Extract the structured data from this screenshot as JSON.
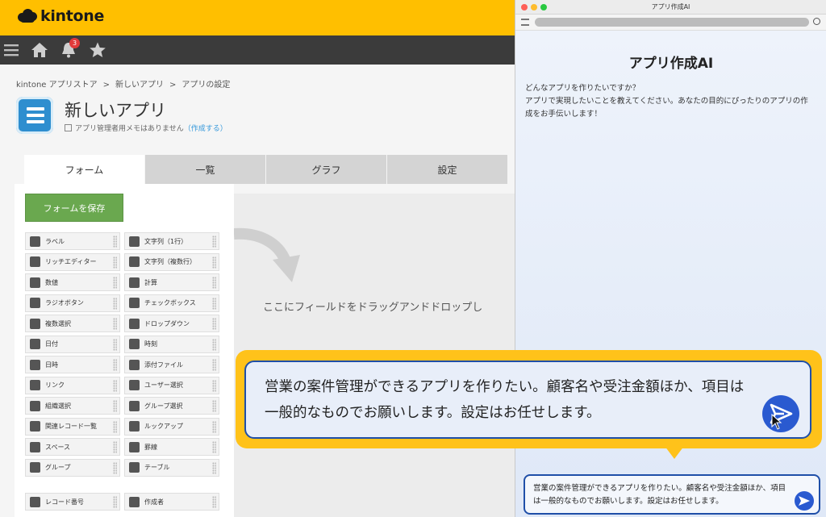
{
  "brand": {
    "logo_text": "kintone"
  },
  "nav": {
    "notification_count": "3"
  },
  "breadcrumb": [
    "kintone アプリストア",
    "新しいアプリ",
    "アプリの設定"
  ],
  "breadcrumb_sep": ">",
  "app": {
    "title": "新しいアプリ",
    "memo": "アプリ管理者用メモはありません",
    "memo_link": "（作成する）"
  },
  "tabs": [
    "フォーム",
    "一覧",
    "グラフ",
    "設定"
  ],
  "form": {
    "save_label": "フォームを保存",
    "fields_left": [
      "ラベル",
      "リッチエディター",
      "数値",
      "ラジオボタン",
      "複数選択",
      "日付",
      "日時",
      "リンク",
      "組織選択",
      "関連レコード一覧",
      "スペース",
      "グループ"
    ],
    "fields_right": [
      "文字列（1行）",
      "文字列（複数行）",
      "計算",
      "チェックボックス",
      "ドロップダウン",
      "時刻",
      "添付ファイル",
      "ユーザー選択",
      "グループ選択",
      "ルックアップ",
      "罫線",
      "テーブル"
    ],
    "fields_bottom_left": [
      "レコード番号"
    ],
    "fields_bottom_right": [
      "作成者"
    ],
    "drop_hint": "ここにフィールドをドラッグアンドドロップし"
  },
  "ai": {
    "window_title": "アプリ作成AI",
    "heading": "アプリ作成AI",
    "intro_line1": "どんなアプリを作りたいですか？",
    "intro_line2": "アプリで実現したいことを教えてください。あなたの目的にぴったりのアプリの作成をお手伝いします！",
    "input_value": "営業の案件管理ができるアプリを作りたい。顧客名や受注金額ほか、項目は一般的なものでお願いします。設定はお任せします。"
  },
  "callout": {
    "text": "営業の案件管理ができるアプリを作りたい。顧客名や受注金額ほか、項目は一般的なものでお願いします。設定はお任せします。"
  },
  "colors": {
    "brand_yellow": "#ffbf00",
    "save_green": "#6aa84f",
    "accent_blue": "#1f4fa8",
    "send_blue": "#2a5ad0"
  }
}
